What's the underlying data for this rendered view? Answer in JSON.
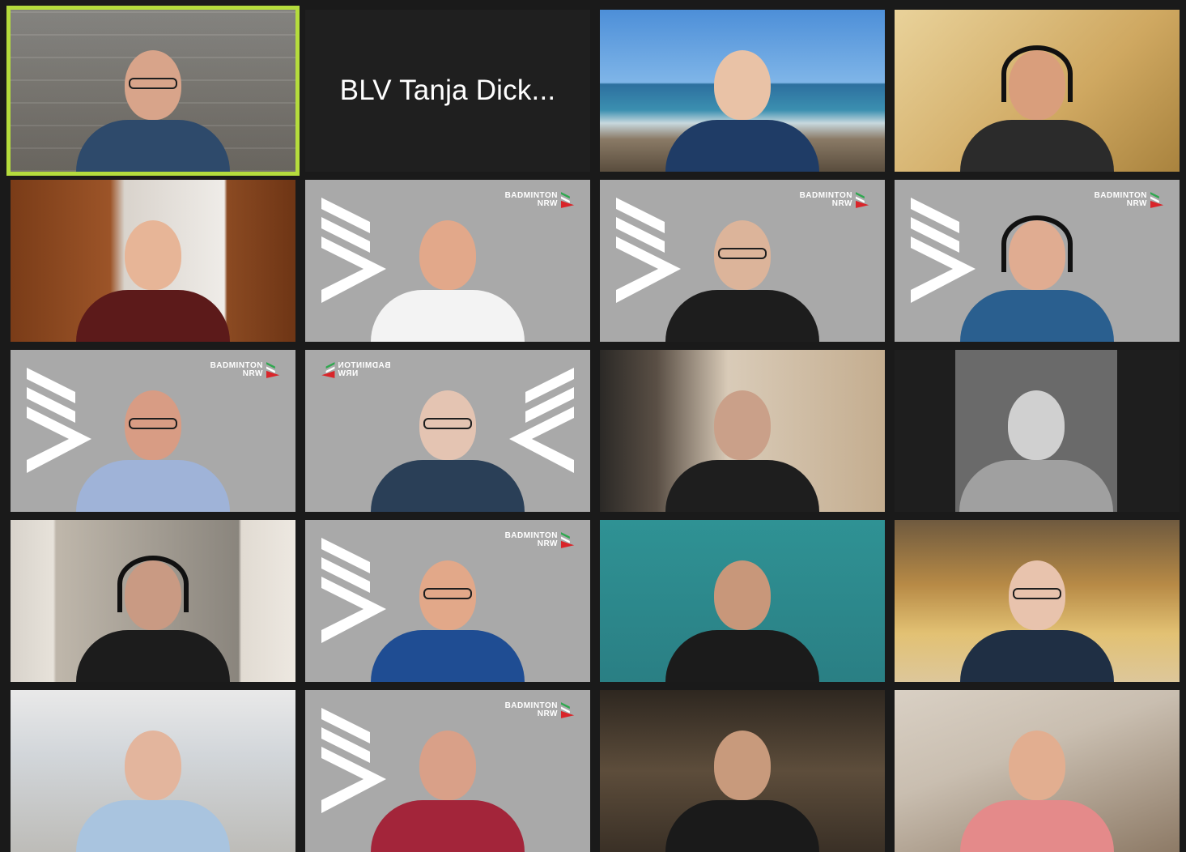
{
  "meeting": {
    "active_speaker_tile": 0,
    "tiles": [
      {
        "kind": "video",
        "bg": "bg-wood",
        "skin": "#d8a48a",
        "shirt": "#2e4a6b",
        "glasses": true,
        "active": true
      },
      {
        "kind": "name",
        "label": "BLV Tanja Dick..."
      },
      {
        "kind": "video",
        "bg": "bg-beach",
        "skin": "#e9c2a6",
        "shirt": "#1f3c66"
      },
      {
        "kind": "video",
        "bg": "bg-warm",
        "skin": "#d99e7c",
        "shirt": "#2b2b2b",
        "headset": true
      },
      {
        "kind": "video",
        "bg": "bg-room",
        "skin": "#e7b597",
        "shirt": "#5c1a1a"
      },
      {
        "kind": "logo",
        "bg": "bg-gray",
        "skin": "#e2a88a",
        "shirt": "#f3f3f3"
      },
      {
        "kind": "logo",
        "bg": "bg-gray",
        "skin": "#dcb49a",
        "shirt": "#1d1d1d",
        "glasses": true
      },
      {
        "kind": "logo",
        "bg": "bg-gray",
        "skin": "#e0ac91",
        "shirt": "#2a5f8f",
        "headset": true
      },
      {
        "kind": "logo",
        "bg": "bg-gray",
        "skin": "#d89c84",
        "shirt": "#9fb3d8",
        "glasses": true
      },
      {
        "kind": "logo-mirror",
        "bg": "bg-gray",
        "skin": "#e4c4b2",
        "shirt": "#2a3f57",
        "glasses": true
      },
      {
        "kind": "video",
        "bg": "bg-kitchen",
        "skin": "#caa089",
        "shirt": "#1e1e1e"
      },
      {
        "kind": "photo-bw",
        "bg": "bg-dark",
        "skin": "#d0d0d0",
        "shirt": "#a0a0a0"
      },
      {
        "kind": "video",
        "bg": "bg-living",
        "skin": "#c99a83",
        "shirt": "#1c1c1c",
        "headset": true
      },
      {
        "kind": "logo",
        "bg": "bg-gray",
        "skin": "#e2a889",
        "shirt": "#1f4d93",
        "glasses": true
      },
      {
        "kind": "video",
        "bg": "bg-teal",
        "skin": "#c8977a",
        "shirt": "#1b1b1b"
      },
      {
        "kind": "video",
        "bg": "bg-books",
        "skin": "#e8c3ad",
        "shirt": "#1f2f44",
        "glasses": true
      },
      {
        "kind": "video",
        "bg": "bg-white-room",
        "skin": "#e3b59d",
        "shirt": "#a9c4df"
      },
      {
        "kind": "logo",
        "bg": "bg-gray",
        "skin": "#d9a088",
        "shirt": "#a3253a"
      },
      {
        "kind": "video",
        "bg": "bg-dim",
        "skin": "#c89a7c",
        "shirt": "#1a1a1a"
      },
      {
        "kind": "video",
        "bg": "bg-attic",
        "skin": "#e2ae90",
        "shirt": "#e48a8a"
      }
    ]
  },
  "brand": {
    "line1": "BADMINTON",
    "line2": "NRW",
    "colors": {
      "green": "#2fa84f",
      "red": "#d9252a",
      "white": "#ffffff"
    }
  }
}
